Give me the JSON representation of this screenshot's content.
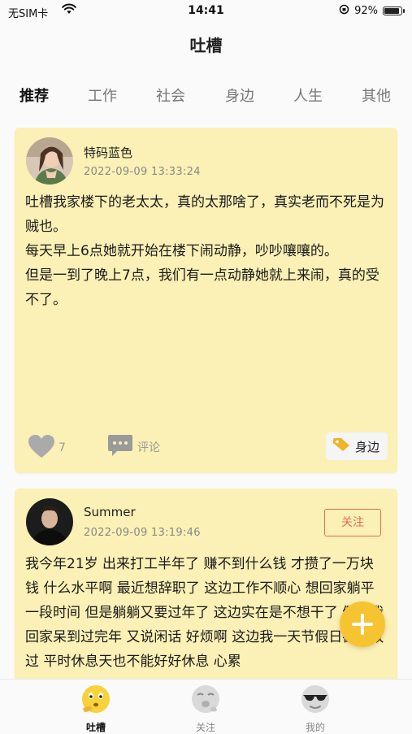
{
  "status_bar": {
    "carrier": "无SIM卡",
    "time": "14:41",
    "battery_text": "92%",
    "battery_level": 0.92
  },
  "nav": {
    "title": "吐槽"
  },
  "tabs": [
    {
      "label": "推荐",
      "active": true
    },
    {
      "label": "工作",
      "active": false
    },
    {
      "label": "社会",
      "active": false
    },
    {
      "label": "身边",
      "active": false
    },
    {
      "label": "人生",
      "active": false
    },
    {
      "label": "其他",
      "active": false
    }
  ],
  "posts": [
    {
      "username": "特码蓝色",
      "timestamp": "2022-09-09 13:33:24",
      "content": "吐槽我家楼下的老太太，真的太那啥了，真实老而不死是为贼也。\n每天早上6点她就开始在楼下闹动静，吵吵嚷嚷的。\n但是一到了晚上7点，我们有一点动静她就上来闹，真的受不了。",
      "likes": "7",
      "comment_label": "评论",
      "tag": "身边"
    },
    {
      "username": "Summer",
      "timestamp": "2022-09-09 13:19:46",
      "follow_label": "关注",
      "content": "我今年21岁 出来打工半年了 赚不到什么钱 才攒了一万块钱 什么水平啊 最近想辞职了 这边工作不顺心 想回家躺平一段时间 但是躺躺又要过年了 这边实在是不想干了 假如我回家呆到过完年 又说闲话 好烦啊 这边我一天节假日都没放过 平时休息天也不能好好休息 心累"
    }
  ],
  "fab": {
    "icon": "plus-icon"
  },
  "bottom_nav": [
    {
      "label": "吐槽",
      "icon": "thinking-face-icon",
      "active": true
    },
    {
      "label": "关注",
      "icon": "yawning-face-icon",
      "active": false
    },
    {
      "label": "我的",
      "icon": "sunglasses-face-icon",
      "active": false
    }
  ],
  "colors": {
    "card_background": "#fbf0b5",
    "accent_yellow": "#f7c431",
    "follow_red": "#e26b5f"
  }
}
